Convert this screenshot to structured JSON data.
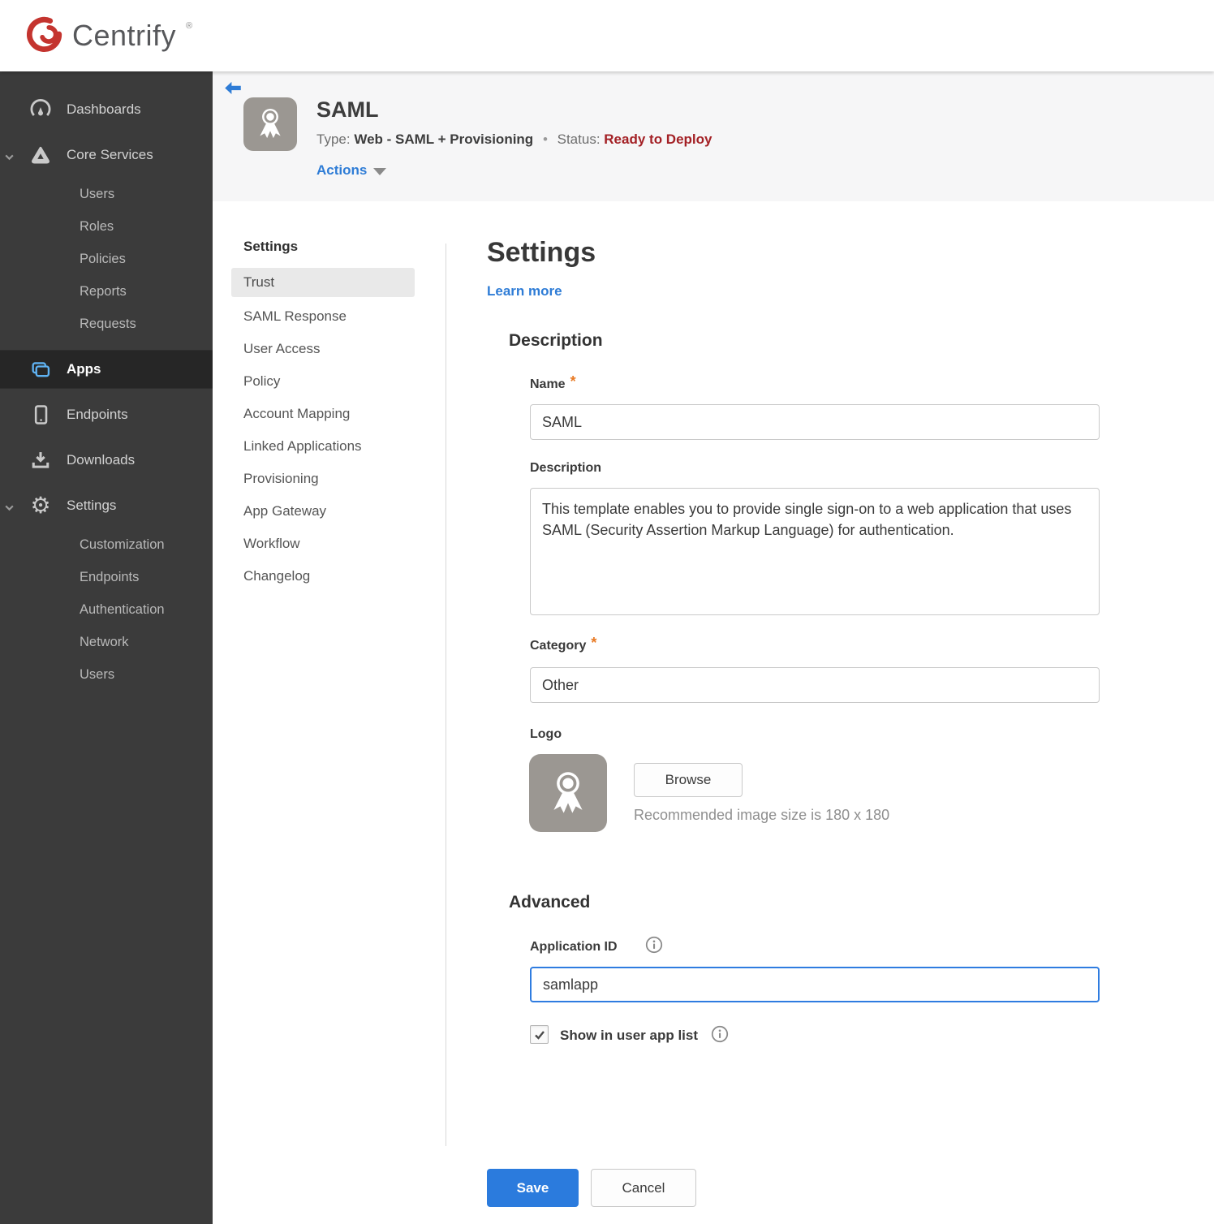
{
  "brand": {
    "name": "Centrify",
    "mark": "®",
    "logo_color": "#c4342f"
  },
  "colors": {
    "accent_blue": "#2e7cd6",
    "focus_blue": "#2f7ce0",
    "status_red": "#a32025",
    "required_orange": "#e87a24",
    "sidebar_bg": "#3b3b3b",
    "sidebar_selected_bg": "#262626",
    "save_button_bg": "#2b7bdd"
  },
  "sidebar": {
    "dashboards": "Dashboards",
    "core_services": "Core Services",
    "core_children": [
      "Users",
      "Roles",
      "Policies",
      "Reports",
      "Requests"
    ],
    "apps": "Apps",
    "endpoints": "Endpoints",
    "downloads": "Downloads",
    "settings": "Settings",
    "settings_children": [
      "Customization",
      "Endpoints",
      "Authentication",
      "Network",
      "Users"
    ]
  },
  "app_header": {
    "title": "SAML",
    "type_label": "Type:",
    "type_value": "Web - SAML + Provisioning",
    "separator": "•",
    "status_label": "Status:",
    "status_value": "Ready to Deploy",
    "actions_label": "Actions"
  },
  "subnav": {
    "header": "Settings",
    "selected": "Trust",
    "items": [
      "Trust",
      "SAML Response",
      "User Access",
      "Policy",
      "Account Mapping",
      "Linked Applications",
      "Provisioning",
      "App Gateway",
      "Workflow",
      "Changelog"
    ]
  },
  "main": {
    "heading": "Settings",
    "learn_more": "Learn more",
    "description_section": {
      "heading": "Description",
      "required_marker": "*",
      "name_label": "Name",
      "name_value": "SAML",
      "description_label": "Description",
      "description_value": "This template enables you to provide single sign-on to a web application that uses SAML (Security Assertion Markup Language) for authentication.",
      "category_label": "Category",
      "category_value": "Other",
      "logo_label": "Logo",
      "browse_button": "Browse",
      "logo_hint": "Recommended image size is 180 x 180"
    },
    "advanced_section": {
      "heading": "Advanced",
      "app_id_label": "Application ID",
      "app_id_value": "samlapp",
      "show_in_app_list_label": "Show in user app list",
      "show_in_app_list_checked": true
    },
    "footer": {
      "save": "Save",
      "cancel": "Cancel"
    }
  }
}
